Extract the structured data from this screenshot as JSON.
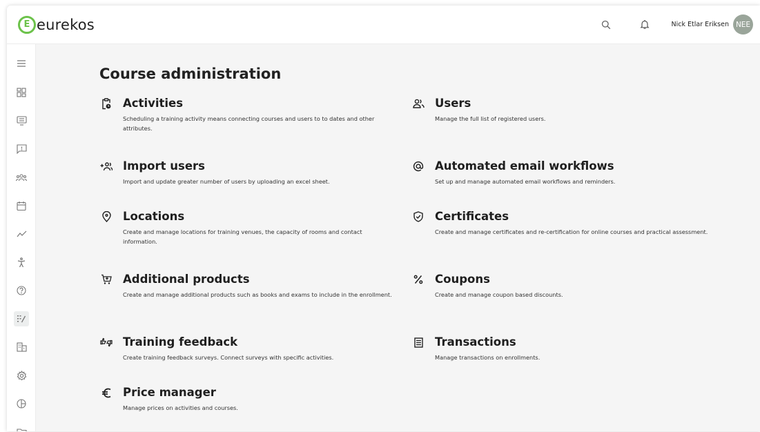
{
  "app": {
    "logo_text": "eurekos",
    "logo_letter": "E",
    "brand_color": "#6cc24a"
  },
  "header": {
    "user_name": "Nick Etlar Eriksen",
    "avatar_initials": "NEE"
  },
  "sidebar": {
    "items": [
      {
        "icon": "menu-icon"
      },
      {
        "icon": "dashboard-icon"
      },
      {
        "icon": "courses-icon"
      },
      {
        "icon": "feedback-icon"
      },
      {
        "icon": "groups-icon"
      },
      {
        "icon": "calendar-icon"
      },
      {
        "icon": "analytics-icon"
      },
      {
        "icon": "training-icon"
      },
      {
        "icon": "help-icon"
      },
      {
        "icon": "course-admin-icon",
        "active": true
      },
      {
        "icon": "organization-icon"
      },
      {
        "icon": "settings-icon"
      },
      {
        "icon": "reports-icon"
      },
      {
        "icon": "folder-icon"
      }
    ]
  },
  "main": {
    "title": "Course administration",
    "cards": [
      {
        "title": "Activities",
        "description": "Scheduling a training activity means connecting courses and users to to dates and other attributes.",
        "icon": "clipboard-clock-icon"
      },
      {
        "title": "Users",
        "description": "Manage the full list of registered users.",
        "icon": "users-icon"
      },
      {
        "title": "Import users",
        "description": "Import and update greater number of users by uploading an excel sheet.",
        "icon": "add-users-icon"
      },
      {
        "title": "Automated email workflows",
        "description": "Set up and manage automated email workflows and reminders.",
        "icon": "at-sign-icon"
      },
      {
        "title": "Locations",
        "description": "Create and manage locations for training venues, the capacity of rooms and contact information.",
        "icon": "location-pin-icon"
      },
      {
        "title": "Certificates",
        "description": "Create and manage certificates and re-certification for online courses and practical assessment.",
        "icon": "shield-check-icon"
      },
      {
        "title": "Additional products",
        "description": "Create and manage additional products such as books and exams to include in the enrollment.",
        "icon": "cart-icon"
      },
      {
        "title": "Coupons",
        "description": "Create and manage coupon based discounts.",
        "icon": "percent-icon"
      },
      {
        "title": "Training feedback",
        "description": "Create training feedback surveys. Connect surveys with specific activities.",
        "icon": "thumbs-icon"
      },
      {
        "title": "Transactions",
        "description": "Manage transactions on enrollments.",
        "icon": "receipt-icon"
      },
      {
        "title": "Price manager",
        "description": "Manage prices on activities and courses.",
        "icon": "euro-icon"
      }
    ]
  }
}
